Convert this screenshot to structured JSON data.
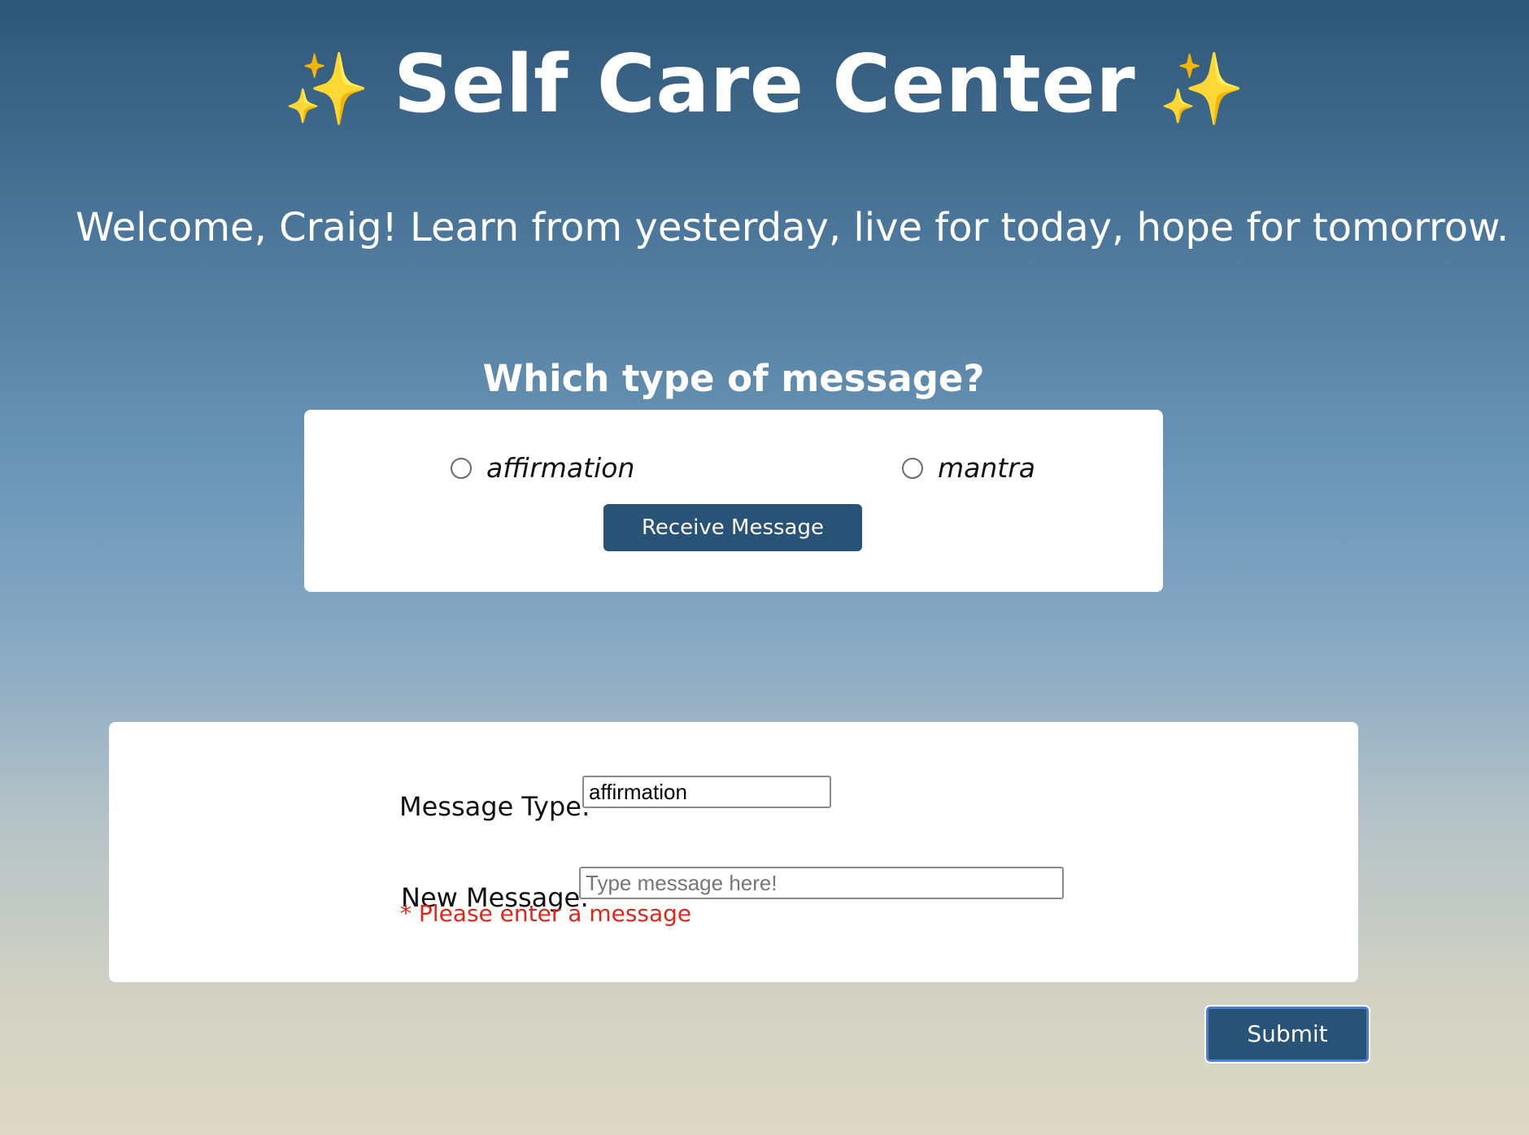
{
  "header": {
    "sparkle_left": "✨",
    "title": "Self Care Center",
    "sparkle_right": "✨"
  },
  "welcome": {
    "text": "Welcome, Craig! Learn from yesterday, live for today, hope for tomorrow."
  },
  "chooser": {
    "question": "Which type of message?",
    "options": [
      {
        "label": "affirmation",
        "checked": false
      },
      {
        "label": "mantra",
        "checked": false
      }
    ],
    "receive_button": "Receive Message"
  },
  "form": {
    "type_label": "Message Type:",
    "type_value": "affirmation",
    "new_label": "New Message:",
    "new_placeholder": "Type message here!",
    "error": "* Please enter a message",
    "submit_button": "Submit"
  },
  "colors": {
    "button": "#285276",
    "error": "#e0261b",
    "focus_ring": "#4a7cd9"
  },
  "icons": [
    "sparkles-icon",
    "radio-icon"
  ]
}
